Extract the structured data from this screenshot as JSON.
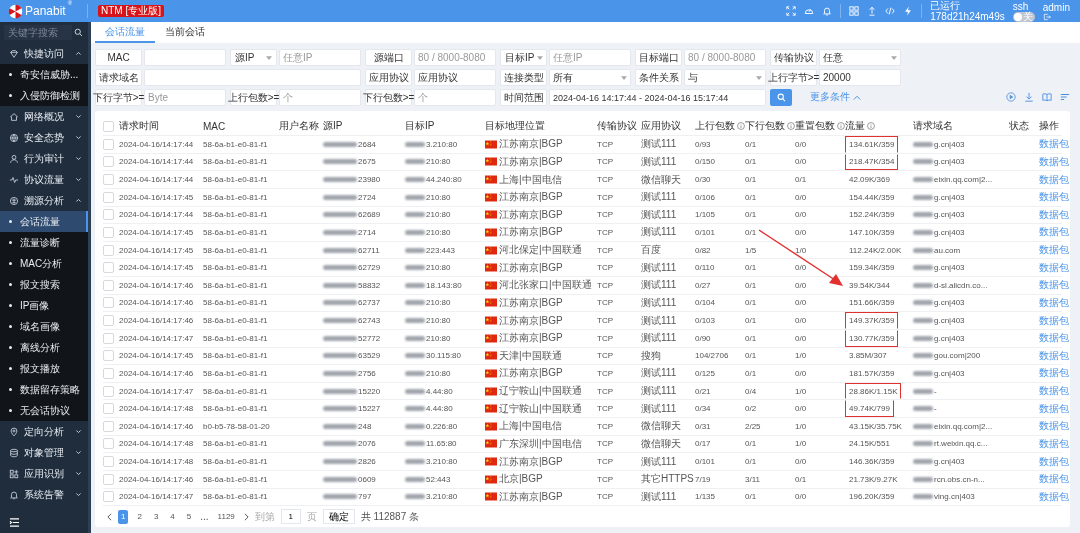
{
  "header": {
    "logo": "Panabit",
    "logo_mark": "®",
    "edition_badge": "NTM [专业版]",
    "uptime_label": "已运行",
    "uptime": "178d21h24m49s",
    "ssh_label": "ssh",
    "ssh_toggle": {
      "on": false,
      "text": "关"
    },
    "user": "admin"
  },
  "sidebar": {
    "search_placeholder": "关键字搜索",
    "items": [
      {
        "label": "快捷访问",
        "expanded": true,
        "children": [
          {
            "label": "奇安信威胁...",
            "selected": false
          },
          {
            "label": "入侵防御检测",
            "selected": false
          }
        ]
      },
      {
        "label": "网络概况",
        "expanded": false
      },
      {
        "label": "安全态势",
        "expanded": false
      },
      {
        "label": "行为审计",
        "expanded": false
      },
      {
        "label": "协议流量",
        "expanded": false
      },
      {
        "label": "溯源分析",
        "expanded": true,
        "children": [
          {
            "label": "会话流量",
            "selected": true
          },
          {
            "label": "流量诊断",
            "selected": false
          },
          {
            "label": "MAC分析",
            "selected": false
          },
          {
            "label": "报文搜索",
            "selected": false
          },
          {
            "label": "IP画像",
            "selected": false
          },
          {
            "label": "域名画像",
            "selected": false
          },
          {
            "label": "离线分析",
            "selected": false
          },
          {
            "label": "报文播放",
            "selected": false
          },
          {
            "label": "数据留存策略",
            "selected": false
          },
          {
            "label": "无会话协议",
            "selected": false
          }
        ]
      },
      {
        "label": "定向分析",
        "expanded": false
      },
      {
        "label": "对象管理",
        "expanded": false
      },
      {
        "label": "应用识别",
        "expanded": false
      },
      {
        "label": "系统告警",
        "expanded": false
      }
    ]
  },
  "tabs": [
    {
      "label": "会话流量",
      "selected": true
    },
    {
      "label": "当前会话",
      "selected": false
    }
  ],
  "filters": [
    [
      {
        "label": "MAC",
        "kind": "input"
      },
      {
        "label": "源IP",
        "kind": "typed_input",
        "placeholder": "任意IP"
      },
      {
        "label": "源端口",
        "kind": "input",
        "placeholder": "80 / 8000-8080"
      },
      {
        "label": "目标IP",
        "kind": "typed_input",
        "placeholder": "任意IP"
      },
      {
        "label": "目标端口",
        "kind": "input",
        "placeholder": "80 / 8000-8080"
      },
      {
        "label": "传输协议",
        "kind": "select",
        "value": "任意"
      }
    ],
    [
      {
        "label": "请求域名",
        "kind": "input"
      },
      {
        "label": "应用协议",
        "kind": "input",
        "value": "应用协议"
      },
      {
        "label": "连接类型",
        "kind": "select",
        "value": "所有"
      },
      {
        "label": "条件关系",
        "kind": "select",
        "value": "与"
      },
      {
        "label": "上行字节>=",
        "kind": "input",
        "value": "20000"
      }
    ],
    [
      {
        "label": "下行字节>=",
        "kind": "input",
        "placeholder": "Byte"
      },
      {
        "label": "上行包数>=",
        "kind": "input",
        "placeholder": "个"
      },
      {
        "label": "下行包数>=",
        "kind": "input",
        "placeholder": "个"
      },
      {
        "label": "时间范围",
        "kind": "input",
        "value": "2024-04-16 14:17:44 - 2024-04-16 15:17:44"
      }
    ]
  ],
  "more_conditions": "更多条件",
  "table": {
    "all_checked": false,
    "columns": [
      {
        "label": "请求时间"
      },
      {
        "label": "MAC"
      },
      {
        "label": "用户名称"
      },
      {
        "label": "源IP"
      },
      {
        "label": "目标IP"
      },
      {
        "label": "目标地理位置"
      },
      {
        "label": "传输协议"
      },
      {
        "label": "应用协议"
      },
      {
        "label": "上行包数",
        "info": true
      },
      {
        "label": "下行包数",
        "info": true
      },
      {
        "label": "重置包数",
        "info": true
      },
      {
        "label": "流量",
        "info": true
      },
      {
        "label": "请求域名"
      },
      {
        "label": "状态"
      },
      {
        "label": "操作"
      }
    ],
    "rows": [
      {
        "checked": false,
        "time": "2024-04-16/14:17:44",
        "mac": "58-6a-b1-e0-81-f1",
        "src_ip": "2684",
        "dst_ip": "3.210:80",
        "geo": "江苏南京|BGP",
        "transport": "TCP",
        "app": "测试111",
        "up": "0/93",
        "down": "0/1",
        "reset": "0/0",
        "flow": "134.61K/359",
        "highlighted": true,
        "domain": "g.cn|403",
        "action": "数据包"
      },
      {
        "checked": false,
        "time": "2024-04-16/14:17:44",
        "mac": "58-6a-b1-e0-81-f1",
        "src_ip": "2675",
        "dst_ip": "210:80",
        "geo": "江苏南京|BGP",
        "transport": "TCP",
        "app": "测试111",
        "up": "0/150",
        "down": "0/1",
        "reset": "0/0",
        "flow": "218.47K/354",
        "highlighted": true,
        "domain": "g.cn|403",
        "action": "数据包"
      },
      {
        "checked": false,
        "time": "2024-04-16/14:17:44",
        "mac": "58-6a-b1-e0-81-f1",
        "src_ip": "23980",
        "dst_ip": "44.240:80",
        "geo": "上海|中国电信",
        "transport": "TCP",
        "app": "微信聊天",
        "up": "0/30",
        "down": "0/1",
        "reset": "0/1",
        "flow": "42.09K/369",
        "highlighted": false,
        "domain": "eixin.qq.com|2...",
        "action": "数据包"
      },
      {
        "checked": false,
        "time": "2024-04-16/14:17:45",
        "mac": "58-6a-b1-e0-81-f1",
        "src_ip": "2724",
        "dst_ip": "210:80",
        "geo": "江苏南京|BGP",
        "transport": "TCP",
        "app": "测试111",
        "up": "0/106",
        "down": "0/1",
        "reset": "0/0",
        "flow": "154.44K/359",
        "highlighted": false,
        "domain": "g.cn|403",
        "action": "数据包"
      },
      {
        "checked": false,
        "time": "2024-04-16/14:17:44",
        "mac": "58-6a-b1-e0-81-f1",
        "src_ip": "62689",
        "dst_ip": "210:80",
        "geo": "江苏南京|BGP",
        "transport": "TCP",
        "app": "测试111",
        "up": "1/105",
        "down": "0/1",
        "reset": "0/0",
        "flow": "152.24K/359",
        "highlighted": false,
        "domain": "g.cn|403",
        "action": "数据包"
      },
      {
        "checked": false,
        "time": "2024-04-16/14:17:45",
        "mac": "58-6a-b1-e0-81-f1",
        "src_ip": "2714",
        "dst_ip": "210:80",
        "geo": "江苏南京|BGP",
        "transport": "TCP",
        "app": "测试111",
        "up": "0/101",
        "down": "0/1",
        "reset": "0/0",
        "flow": "147.10K/359",
        "highlighted": false,
        "domain": "g.cn|403",
        "action": "数据包"
      },
      {
        "checked": false,
        "time": "2024-04-16/14:17:45",
        "mac": "58-6a-b1-e0-81-f1",
        "src_ip": "62711",
        "dst_ip": "223:443",
        "geo": "河北保定|中国联通",
        "transport": "TCP",
        "app": "百度",
        "up": "0/82",
        "down": "1/5",
        "reset": "1/0",
        "flow": "112.24K/2.00K",
        "highlighted": false,
        "domain": "au.com",
        "action": "数据包"
      },
      {
        "checked": false,
        "time": "2024-04-16/14:17:45",
        "mac": "58-6a-b1-e0-81-f1",
        "src_ip": "62729",
        "dst_ip": "210:80",
        "geo": "江苏南京|BGP",
        "transport": "TCP",
        "app": "测试111",
        "up": "0/110",
        "down": "0/1",
        "reset": "0/0",
        "flow": "159.34K/359",
        "highlighted": false,
        "domain": "g.cn|403",
        "action": "数据包"
      },
      {
        "checked": false,
        "time": "2024-04-16/14:17:46",
        "mac": "58-6a-b1-e0-81-f1",
        "src_ip": "58832",
        "dst_ip": "18.143:80",
        "geo": "河北张家口|中国联通",
        "transport": "TCP",
        "app": "测试111",
        "up": "0/27",
        "down": "0/1",
        "reset": "0/0",
        "flow": "39.54K/344",
        "highlighted": false,
        "domain": "d-sl.alicdn.co...",
        "action": "数据包"
      },
      {
        "checked": false,
        "time": "2024-04-16/14:17:46",
        "mac": "58-6a-b1-e0-81-f1",
        "src_ip": "62737",
        "dst_ip": "210:80",
        "geo": "江苏南京|BGP",
        "transport": "TCP",
        "app": "测试111",
        "up": "0/104",
        "down": "0/1",
        "reset": "0/0",
        "flow": "151.66K/359",
        "highlighted": false,
        "domain": "g.cn|403",
        "action": "数据包"
      },
      {
        "checked": false,
        "time": "2024-04-16/14:17:46",
        "mac": "58-6a-b1-e0-81-f1",
        "src_ip": "62743",
        "dst_ip": "210:80",
        "geo": "江苏南京|BGP",
        "transport": "TCP",
        "app": "测试111",
        "up": "0/103",
        "down": "0/1",
        "reset": "0/0",
        "flow": "149.37K/359",
        "highlighted": true,
        "domain": "g.cn|403",
        "action": "数据包"
      },
      {
        "checked": false,
        "time": "2024-04-16/14:17:47",
        "mac": "58-6a-b1-e0-81-f1",
        "src_ip": "52772",
        "dst_ip": "210:80",
        "geo": "江苏南京|BGP",
        "transport": "TCP",
        "app": "测试111",
        "up": "0/90",
        "down": "0/1",
        "reset": "0/0",
        "flow": "130.77K/359",
        "highlighted": true,
        "domain": "g.cn|403",
        "action": "数据包"
      },
      {
        "checked": false,
        "time": "2024-04-16/14:17:45",
        "mac": "58-6a-b1-e0-81-f1",
        "src_ip": "63529",
        "dst_ip": "30.115:80",
        "geo": "天津|中国联通",
        "transport": "TCP",
        "app": "搜狗",
        "up": "104/2706",
        "down": "0/1",
        "reset": "1/0",
        "flow": "3.85M/307",
        "highlighted": false,
        "domain": "gou.com|200",
        "action": "数据包"
      },
      {
        "checked": false,
        "time": "2024-04-16/14:17:46",
        "mac": "58-6a-b1-e0-81-f1",
        "src_ip": "2756",
        "dst_ip": "210:80",
        "geo": "江苏南京|BGP",
        "transport": "TCP",
        "app": "测试111",
        "up": "0/125",
        "down": "0/1",
        "reset": "0/0",
        "flow": "181.57K/359",
        "highlighted": false,
        "domain": "g.cn|403",
        "action": "数据包"
      },
      {
        "checked": false,
        "time": "2024-04-16/14:17:47",
        "mac": "58-6a-b1-e0-81-f1",
        "src_ip": "15220",
        "dst_ip": "4.44:80",
        "geo": "辽宁鞍山|中国联通",
        "transport": "TCP",
        "app": "测试111",
        "up": "0/21",
        "down": "0/4",
        "reset": "1/0",
        "flow": "28.86K/1.15K",
        "highlighted": true,
        "domain": "-",
        "action": "数据包"
      },
      {
        "checked": false,
        "time": "2024-04-16/14:17:48",
        "mac": "58-6a-b1-e0-81-f1",
        "src_ip": "15227",
        "dst_ip": "4.44:80",
        "geo": "辽宁鞍山|中国联通",
        "transport": "TCP",
        "app": "测试111",
        "up": "0/34",
        "down": "0/2",
        "reset": "0/0",
        "flow": "49.74K/799",
        "highlighted": true,
        "domain": "-",
        "action": "数据包"
      },
      {
        "checked": false,
        "time": "2024-04-16/14:17:46",
        "mac": "b0-b5-78-58-01-20",
        "src_ip": "248",
        "dst_ip": "0.226:80",
        "geo": "上海|中国电信",
        "transport": "TCP",
        "app": "微信聊天",
        "up": "0/31",
        "down": "2/25",
        "reset": "1/0",
        "flow": "43.15K/35.75K",
        "highlighted": false,
        "domain": "eixin.qq.com|2...",
        "action": "数据包"
      },
      {
        "checked": false,
        "time": "2024-04-16/14:17:48",
        "mac": "58-6a-b1-e0-81-f1",
        "src_ip": "2076",
        "dst_ip": "11.65:80",
        "geo": "广东深圳|中国电信",
        "transport": "TCP",
        "app": "微信聊天",
        "up": "0/17",
        "down": "0/1",
        "reset": "1/0",
        "flow": "24.15K/551",
        "highlighted": false,
        "domain": "rt.weixin.qq.c...",
        "action": "数据包"
      },
      {
        "checked": false,
        "time": "2024-04-16/14:17:48",
        "mac": "58-6a-b1-e0-81-f1",
        "src_ip": "2826",
        "dst_ip": "3.210:80",
        "geo": "江苏南京|BGP",
        "transport": "TCP",
        "app": "测试111",
        "up": "0/101",
        "down": "0/1",
        "reset": "0/0",
        "flow": "146.36K/359",
        "highlighted": false,
        "domain": "g.cn|403",
        "action": "数据包"
      },
      {
        "checked": false,
        "time": "2024-04-16/14:17:46",
        "mac": "58-6a-b1-e0-81-f1",
        "src_ip": "0609",
        "dst_ip": "52:443",
        "geo": "北京|BGP",
        "transport": "TCP",
        "app": "其它HTTPS",
        "up": "7/19",
        "down": "3/11",
        "reset": "0/1",
        "flow": "21.73K/9.27K",
        "highlighted": false,
        "domain": "rcn.obs.cn-n...",
        "action": "数据包"
      },
      {
        "checked": false,
        "time": "2024-04-16/14:17:47",
        "mac": "58-6a-b1-e0-81-f1",
        "src_ip": "797",
        "dst_ip": "3.210:80",
        "geo": "江苏南京|BGP",
        "transport": "TCP",
        "app": "测试111",
        "up": "1/135",
        "down": "0/1",
        "reset": "0/0",
        "flow": "196.20K/359",
        "highlighted": false,
        "domain": "ving.cn|403",
        "action": "数据包"
      }
    ]
  },
  "pagination": {
    "pages": [
      {
        "label": "1",
        "selected": true
      },
      {
        "label": "2",
        "selected": false
      },
      {
        "label": "3",
        "selected": false
      },
      {
        "label": "4",
        "selected": false
      },
      {
        "label": "5",
        "selected": false
      }
    ],
    "ellipsis": "...",
    "last_page": "1129",
    "goto_label": "到第",
    "goto_value": "1",
    "page_unit": "页",
    "confirm": "确定",
    "total": "共 112887 条"
  }
}
